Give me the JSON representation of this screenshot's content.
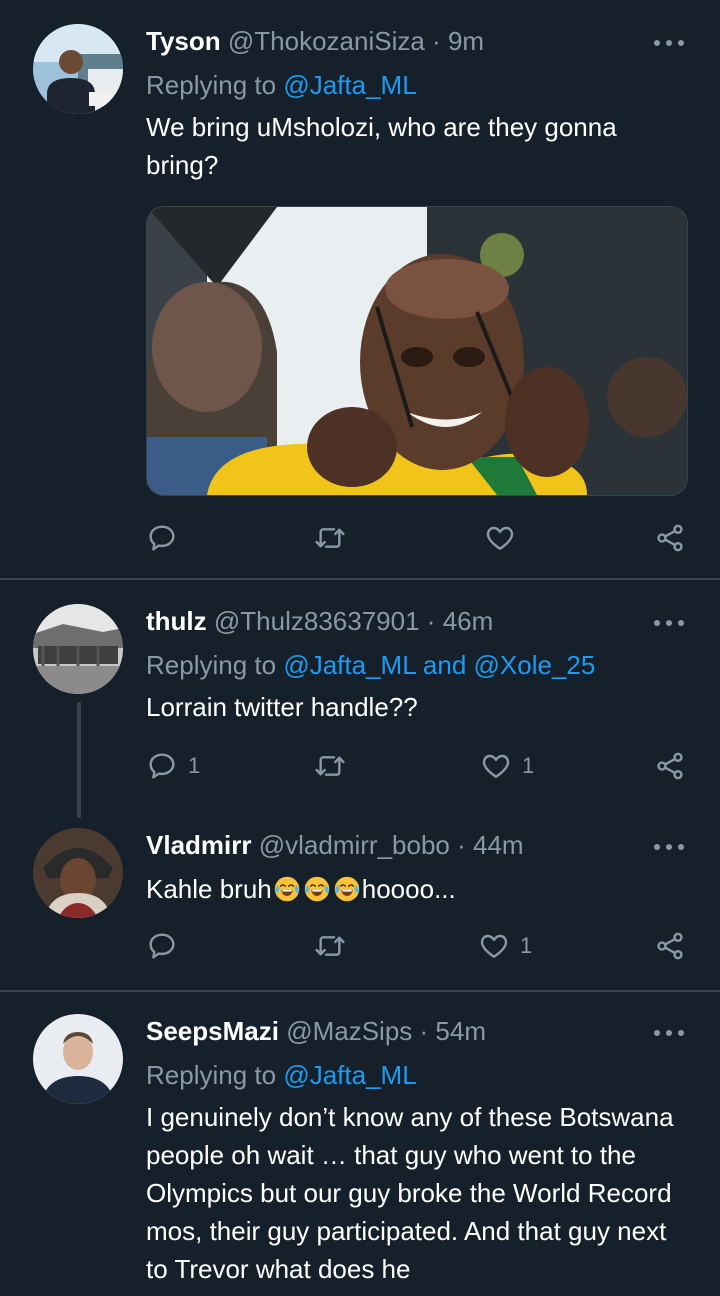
{
  "colors": {
    "background": "#15202b",
    "text_primary": "#ffffff",
    "text_secondary": "#8b98a5",
    "link": "#1d9bf0",
    "divider": "#38444d"
  },
  "tweets": [
    {
      "name": "Tyson",
      "handle": "@ThokozaniSiza",
      "sep": "·",
      "time": "9m",
      "replying_prefix": "Replying to ",
      "replying_to": "@Jafta_ML",
      "text": "We bring uMsholozi, who are they gonna bring?",
      "actions": {
        "reply": "",
        "retweet": "",
        "like": ""
      },
      "icons": [
        "comment-icon",
        "retweet-icon",
        "heart-icon",
        "share-icon"
      ]
    },
    {
      "name": "thulz",
      "handle": "@Thulz83637901",
      "sep": "·",
      "time": "46m",
      "replying_prefix": "Replying to ",
      "replying_to": "@Jafta_ML and @Xole_25",
      "text": "Lorrain twitter handle??",
      "actions": {
        "reply": "1",
        "retweet": "",
        "like": "1"
      }
    },
    {
      "name": "Vladmirr",
      "handle": "@vladmirr_bobo",
      "sep": "·",
      "time": "44m",
      "text_before": "Kahle bruh",
      "emoji": "face-with-tears-of-joy",
      "text_after": "hoooo...",
      "actions": {
        "reply": "",
        "retweet": "",
        "like": "1"
      }
    },
    {
      "name": "SeepsMazi",
      "handle": "@MazSips",
      "sep": "·",
      "time": "54m",
      "replying_prefix": "Replying to ",
      "replying_to": "@Jafta_ML",
      "text": "I genuinely don’t know any of these Botswana people oh wait … that guy who went to the Olympics but our guy broke the World Record mos, their guy participated. And that guy next to Trevor what does he"
    }
  ]
}
